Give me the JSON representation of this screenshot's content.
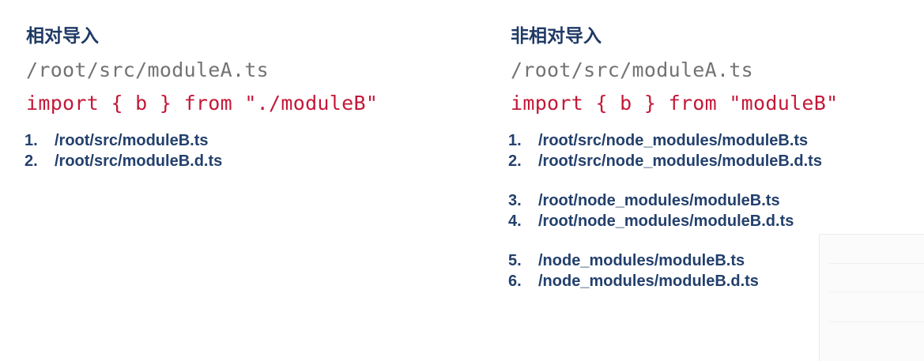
{
  "relative": {
    "heading": "相对导入",
    "path": "/root/src/moduleA.ts",
    "import": "import { b } from \"./moduleB\"",
    "items": [
      {
        "num": "1.",
        "text": "/root/src/moduleB.ts"
      },
      {
        "num": "2.",
        "text": "/root/src/moduleB.d.ts"
      }
    ]
  },
  "nonrelative": {
    "heading": "非相对导入",
    "path": "/root/src/moduleA.ts",
    "import": "import { b } from \"moduleB\"",
    "items": [
      {
        "num": "1.",
        "text": "/root/src/node_modules/moduleB.ts"
      },
      {
        "num": "2.",
        "text": "/root/src/node_modules/moduleB.d.ts"
      },
      {
        "num": "3.",
        "text": "/root/node_modules/moduleB.ts"
      },
      {
        "num": "4.",
        "text": "/root/node_modules/moduleB.d.ts"
      },
      {
        "num": "5.",
        "text": "/node_modules/moduleB.ts"
      },
      {
        "num": "6.",
        "text": "/node_modules/moduleB.d.ts"
      }
    ]
  },
  "colors": {
    "heading": "#1f3a66",
    "path": "#737373",
    "import": "#c41838",
    "list": "#23406d"
  }
}
